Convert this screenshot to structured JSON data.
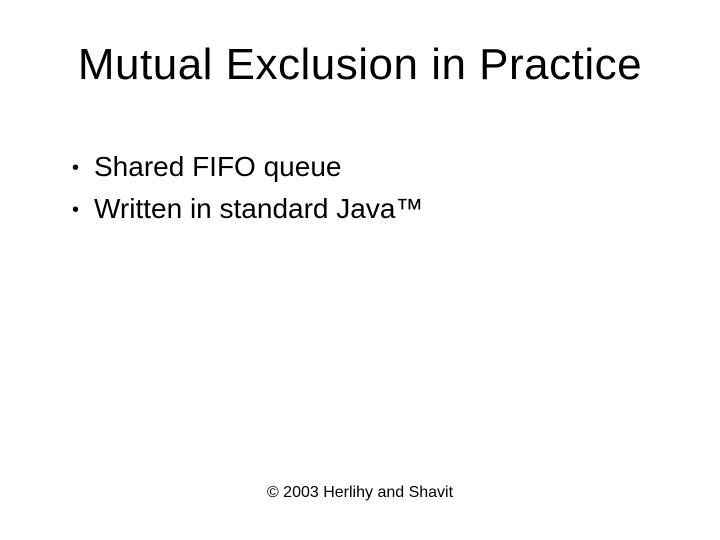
{
  "title": "Mutual Exclusion in Practice",
  "bullets": [
    {
      "text": "Shared FIFO queue"
    },
    {
      "text": "Written in standard Java™"
    }
  ],
  "footer": "© 2003 Herlihy and Shavit"
}
